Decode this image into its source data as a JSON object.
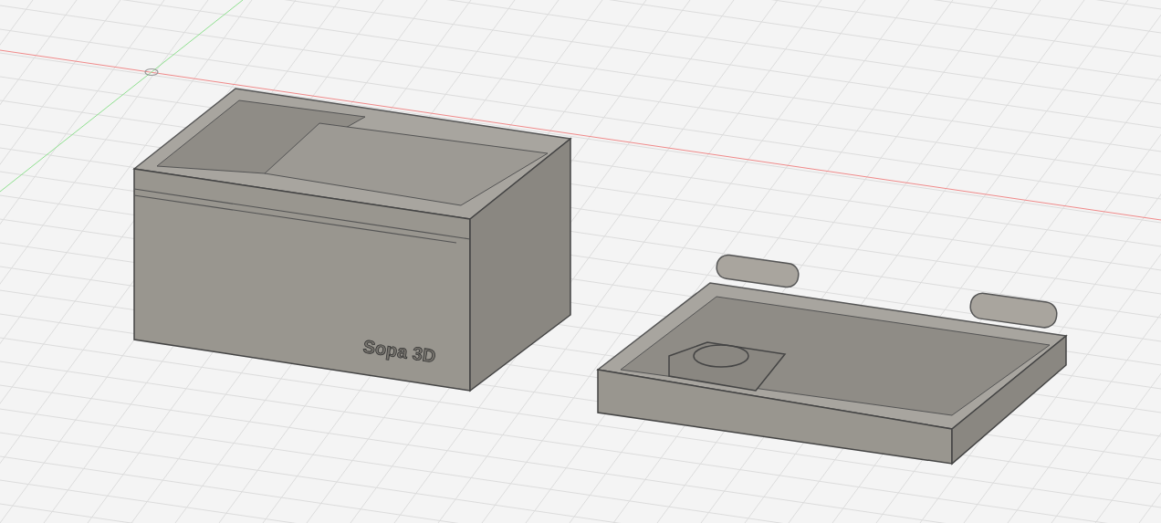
{
  "viewport": {
    "model_label": "Sopa 3D"
  }
}
